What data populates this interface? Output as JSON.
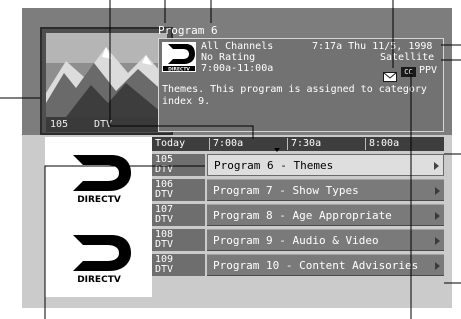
{
  "preview": {
    "channel": "105",
    "network": "DTV"
  },
  "program": {
    "title": "Program 6",
    "channel_group": "All Channels",
    "rating": "No Rating",
    "time_range": "7:00a-11:00a",
    "datetime": "7:17a Thu 11/5, 1998",
    "source": "Satellite",
    "ppv": "PPV",
    "cc_badge": "CC",
    "description": "Themes. This program is assigned to category index 9."
  },
  "logo": {
    "brand": "DIRECTV"
  },
  "time_header": {
    "today": "Today",
    "slots": [
      "7:00a",
      "7:30a",
      "8:00a"
    ]
  },
  "rows": [
    {
      "channel": "105",
      "network": "DTV",
      "program": "Program 6 - Themes"
    },
    {
      "channel": "106",
      "network": "DTV",
      "program": "Program 7 - Show Types"
    },
    {
      "channel": "107",
      "network": "DTV",
      "program": "Program 8 - Age Appropriate"
    },
    {
      "channel": "108",
      "network": "DTV",
      "program": "Program 9 - Audio & Video"
    },
    {
      "channel": "109",
      "network": "DTV",
      "program": "Program 10 - Content Advisories"
    }
  ],
  "colors": {
    "banner": "#7d7d7d",
    "panel": "#727272",
    "selected_row": "#dedede",
    "row": "#7a7a7a",
    "background": "#cbcbcb"
  },
  "icons": [
    "mail-icon",
    "closed-caption-icon",
    "directv-logo-icon",
    "row-arrow-icon"
  ]
}
